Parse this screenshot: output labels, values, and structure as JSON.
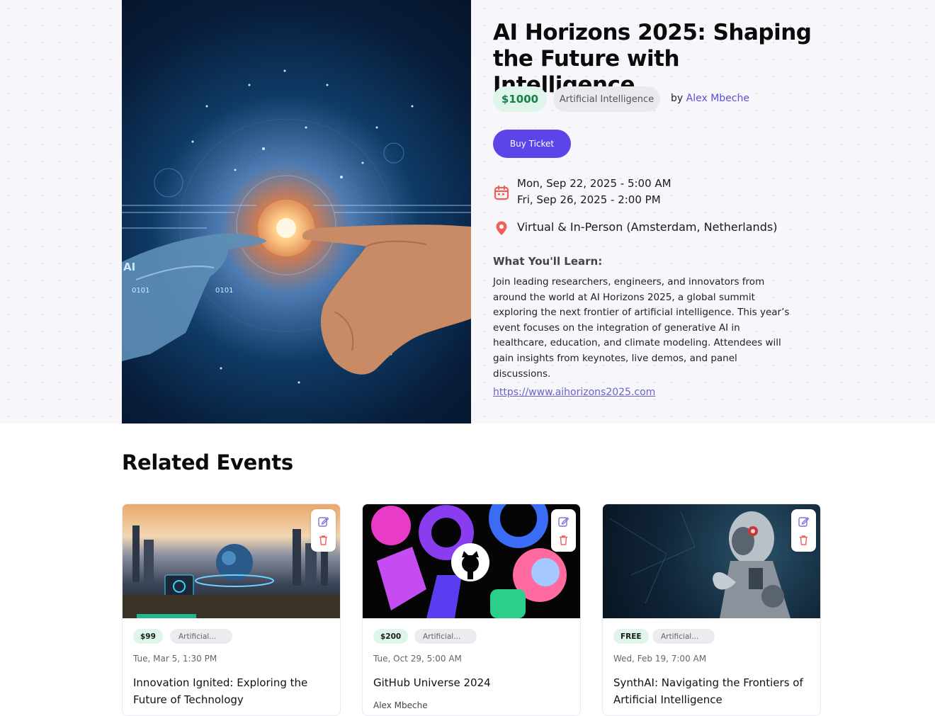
{
  "event": {
    "title": "AI Horizons 2025: Shaping the Future with Intelligence",
    "price": "$1000",
    "category": "Artificial Intelligence",
    "by_label": "by",
    "organizer": "Alex Mbeche",
    "buy_label": "Buy Ticket",
    "start": "Mon, Sep 22, 2025 - 5:00 AM",
    "end": "Fri, Sep 26, 2025 - 2:00 PM",
    "location": "Virtual & In-Person (Amsterdam, Netherlands)",
    "learn_heading": "What You'll Learn:",
    "description": "Join leading researchers, engineers, and innovators from around the world at AI Horizons 2025, a global summit exploring the next frontier of artificial intelligence. This year’s event focuses on the integration of generative AI in healthcare, education, and climate modeling. Attendees will gain insights from keynotes, live demos, and panel discussions.",
    "link": "https://www.aihorizons2025.com",
    "image_text_ai": "AI",
    "image_text_0101a": "0101",
    "image_text_0101b": "0101"
  },
  "related": {
    "heading": "Related Events",
    "cards": [
      {
        "price": "$99",
        "category": "Artificial...",
        "date": "Tue, Mar 5, 1:30 PM",
        "title": "Innovation Ignited: Exploring the Future of Technology",
        "organizer": ""
      },
      {
        "price": "$200",
        "category": "Artificial...",
        "date": "Tue, Oct 29, 5:00 AM",
        "title": "GitHub Universe 2024",
        "organizer": "Alex Mbeche"
      },
      {
        "price": "FREE",
        "category": "Artificial...",
        "date": "Wed, Feb 19, 7:00 AM",
        "title": "SynthAI: Navigating the Frontiers of Artificial Intelligence",
        "organizer": ""
      }
    ]
  },
  "colors": {
    "accent": "#5b45e8",
    "price_green": "#16804a",
    "link": "#6a63c9",
    "icon_red": "#f0605a"
  },
  "icons": [
    "calendar-icon",
    "location-pin-icon",
    "edit-icon",
    "trash-icon"
  ]
}
